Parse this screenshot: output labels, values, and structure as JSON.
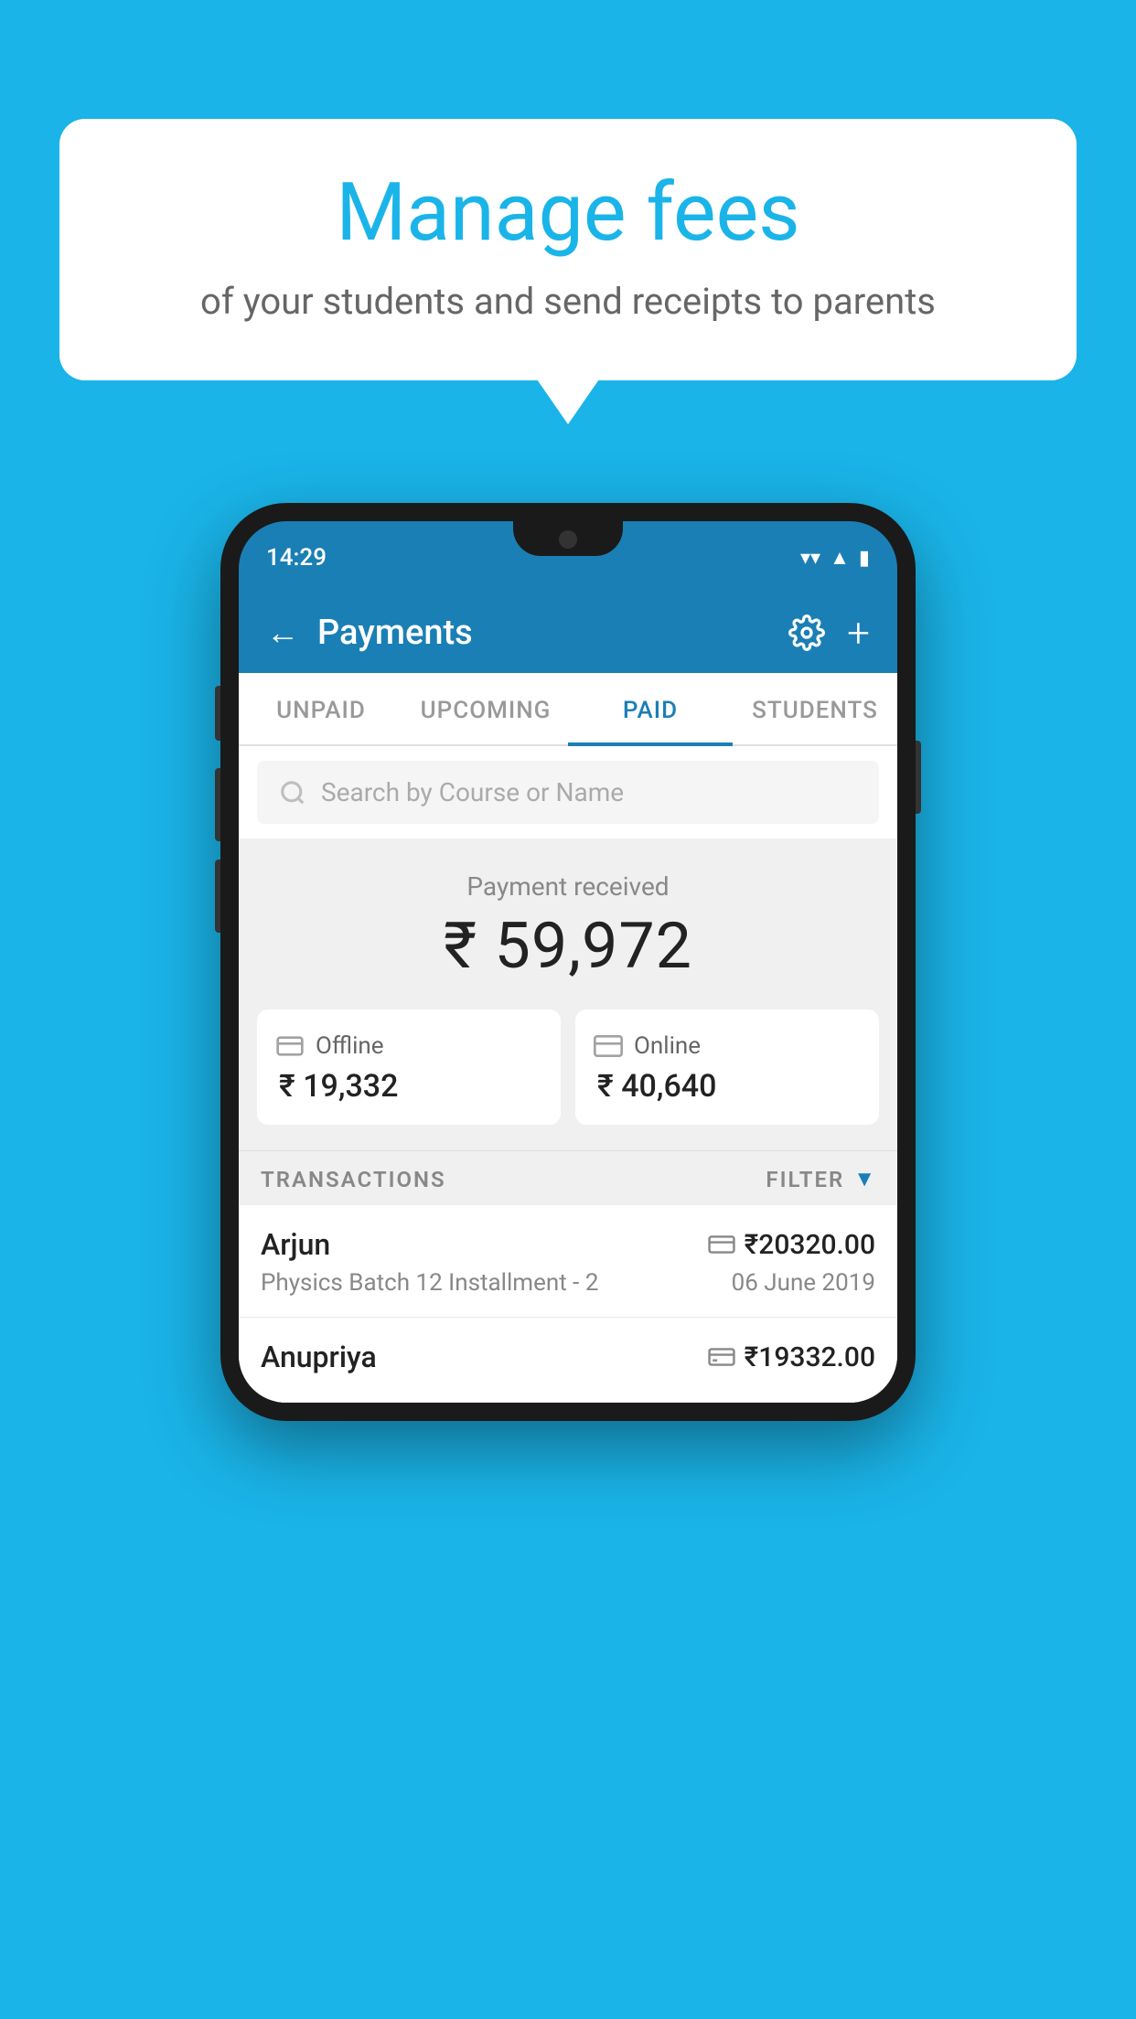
{
  "background_color": "#1ab4e8",
  "speech_bubble": {
    "title": "Manage fees",
    "subtitle": "of your students and send receipts to parents"
  },
  "phone": {
    "status_bar": {
      "time": "14:29",
      "wifi_icon": "▼",
      "signal_icon": "▲",
      "battery_icon": "▌"
    },
    "header": {
      "back_label": "←",
      "title": "Payments",
      "gear_icon": "gear",
      "plus_icon": "+"
    },
    "tabs": [
      {
        "label": "UNPAID",
        "active": false
      },
      {
        "label": "UPCOMING",
        "active": false
      },
      {
        "label": "PAID",
        "active": true
      },
      {
        "label": "STUDENTS",
        "active": false
      }
    ],
    "search": {
      "placeholder": "Search by Course or Name"
    },
    "payment_summary": {
      "label": "Payment received",
      "amount": "₹ 59,972"
    },
    "payment_cards": [
      {
        "label": "Offline",
        "amount": "₹ 19,332",
        "icon": "offline"
      },
      {
        "label": "Online",
        "amount": "₹ 40,640",
        "icon": "online"
      }
    ],
    "transactions_section": {
      "header_label": "TRANSACTIONS",
      "filter_label": "FILTER"
    },
    "transactions": [
      {
        "name": "Arjun",
        "detail": "Physics Batch 12 Installment - 2",
        "amount": "₹20320.00",
        "date": "06 June 2019",
        "payment_type": "card"
      },
      {
        "name": "Anupriya",
        "detail": "",
        "amount": "₹19332.00",
        "date": "",
        "payment_type": "offline"
      }
    ]
  }
}
